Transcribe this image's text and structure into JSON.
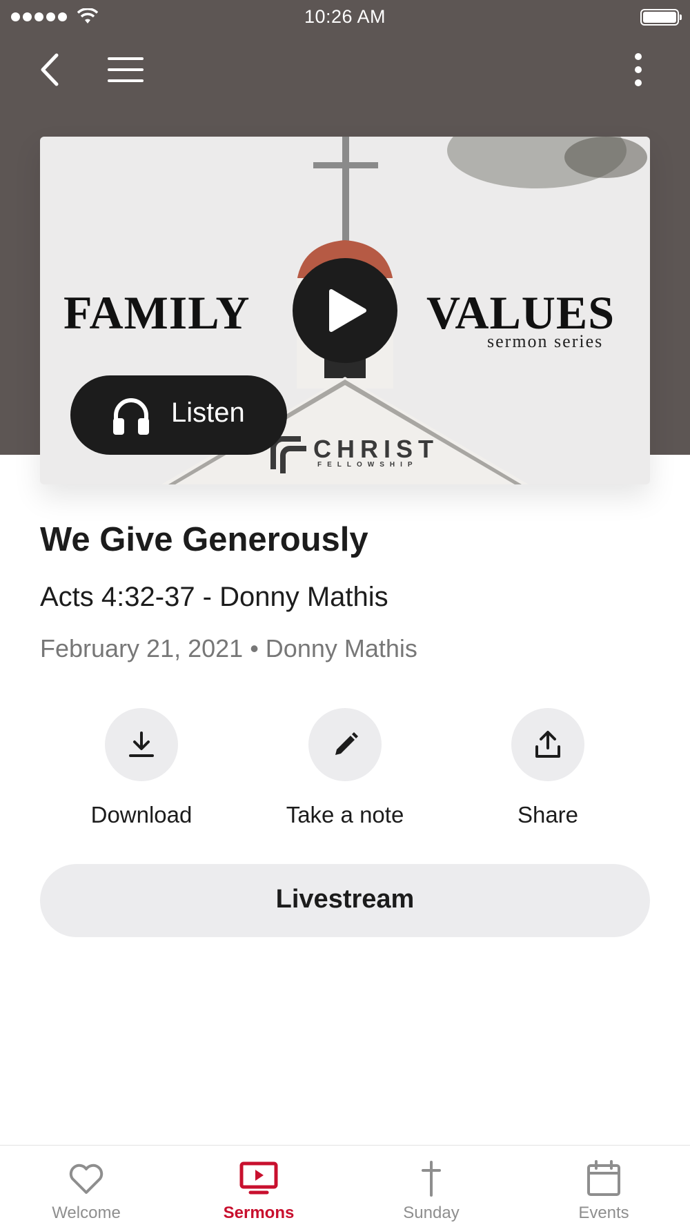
{
  "status_bar": {
    "time": "10:26 AM"
  },
  "artwork": {
    "title_left": "FAMILY",
    "title_right": "VALUES",
    "subtitle": "sermon series",
    "logo_name": "CHRIST",
    "logo_sub": "FELLOWSHIP"
  },
  "listen_label": "Listen",
  "sermon": {
    "title": "We Give Generously",
    "subtitle": "Acts 4:32-37 - Donny Mathis",
    "meta": "February 21, 2021 • Donny Mathis"
  },
  "actions": [
    {
      "label": "Download",
      "icon": "download-icon"
    },
    {
      "label": "Take a note",
      "icon": "pencil-icon"
    },
    {
      "label": "Share",
      "icon": "share-icon"
    }
  ],
  "livestream_label": "Livestream",
  "tabs": [
    {
      "label": "Welcome",
      "icon": "heart-icon",
      "active": false
    },
    {
      "label": "Sermons",
      "icon": "tv-play-icon",
      "active": true
    },
    {
      "label": "Sunday",
      "icon": "cross-icon",
      "active": false
    },
    {
      "label": "Events",
      "icon": "calendar-icon",
      "active": false
    }
  ],
  "colors": {
    "accent": "#c8102e",
    "header": "#5d5654",
    "button_dark": "#1c1c1c",
    "chip": "#ececee"
  }
}
